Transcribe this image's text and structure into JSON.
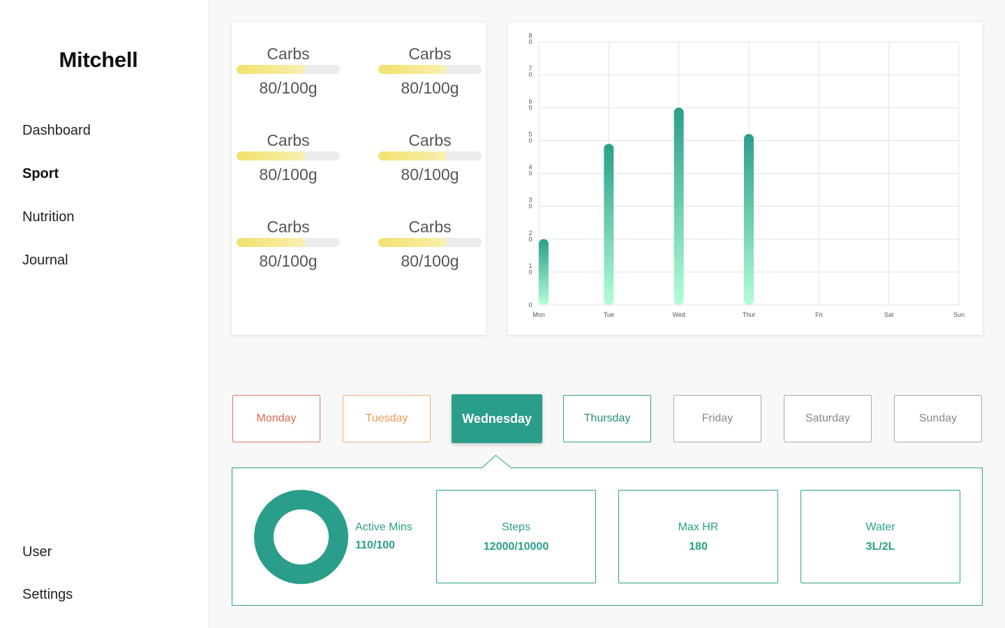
{
  "brand": "Mitchell",
  "nav": {
    "dashboard": "Dashboard",
    "sport": "Sport",
    "nutrition": "Nutrition",
    "journal": "Journal",
    "user": "User",
    "settings": "Settings"
  },
  "macros": [
    {
      "label": "Carbs",
      "value": "80/100g",
      "progress": 0.66
    },
    {
      "label": "Carbs",
      "value": "80/100g",
      "progress": 0.66
    },
    {
      "label": "Carbs",
      "value": "80/100g",
      "progress": 0.66
    },
    {
      "label": "Carbs",
      "value": "80/100g",
      "progress": 0.66
    },
    {
      "label": "Carbs",
      "value": "80/100g",
      "progress": 0.66
    },
    {
      "label": "Carbs",
      "value": "80/100g",
      "progress": 0.66
    }
  ],
  "chart_data": {
    "type": "bar",
    "categories": [
      "Mon",
      "Tue",
      "Wed",
      "Thur",
      "Fri",
      "Sat",
      "Sun"
    ],
    "values": [
      20,
      49,
      60,
      52,
      null,
      null,
      null
    ],
    "y_ticks": [
      "0",
      "10",
      "20",
      "30",
      "40",
      "50",
      "60",
      "70",
      "80"
    ],
    "ylim": [
      0,
      80
    ],
    "grid": true,
    "colors": {
      "bar_top": "#2b9e8b",
      "bar_bottom": "#b3fdd6"
    }
  },
  "days": {
    "monday": "Monday",
    "tuesday": "Tuesday",
    "wednesday": "Wednesday",
    "thursday": "Thursday",
    "friday": "Friday",
    "saturday": "Saturday",
    "sunday": "Sunday",
    "selected": "Wednesday"
  },
  "details": {
    "active_mins": {
      "label": "Active Mins",
      "value": "110/100"
    },
    "steps": {
      "label": "Steps",
      "value": "12000/10000"
    },
    "max_hr": {
      "label": "Max HR",
      "value": "180"
    },
    "water": {
      "label": "Water",
      "value": "3L/2L"
    }
  },
  "colors": {
    "accent": "#2b9e8b",
    "monday": "#e06a50",
    "tuesday": "#ef9a52"
  }
}
